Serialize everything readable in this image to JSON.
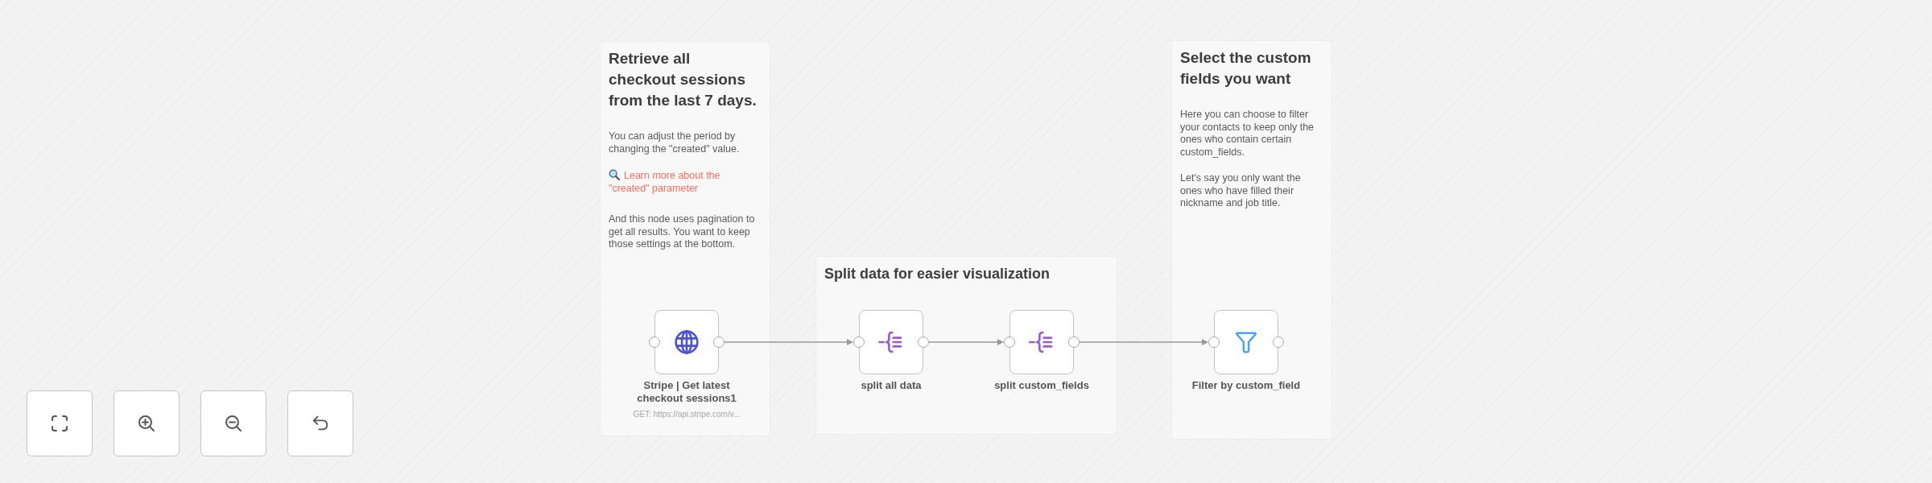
{
  "canvas": {
    "sticky_notes": [
      {
        "heading": "Retrieve all checkout sessions from the last 7 days.",
        "paragraphs": [
          {
            "kind": "text",
            "text": "You can adjust the period by changing the \"created\" value."
          },
          {
            "kind": "link",
            "text": "Learn more about the \"created\" parameter"
          },
          {
            "kind": "text",
            "text": "And this node uses pagination to get all results. You want to keep those settings at the bottom."
          }
        ]
      },
      {
        "heading": "Split data for easier visualization"
      },
      {
        "heading": "Select the custom fields you want",
        "paragraphs": [
          {
            "kind": "text",
            "text": "Here you can choose to filter your contacts to keep only the ones who contain certain custom_fields."
          },
          {
            "kind": "text",
            "text": "Let's say you only want the ones who have filled their nickname and job title."
          }
        ]
      }
    ],
    "nodes": [
      {
        "kind": "http",
        "name": "Stripe | Get latest checkout sessions1",
        "subtitle": "GET: https://api.stripe.com/v..."
      },
      {
        "kind": "split",
        "name": "split all data"
      },
      {
        "kind": "split",
        "name": "split custom_fields"
      },
      {
        "kind": "filter",
        "name": "Filter by custom_field"
      }
    ]
  }
}
